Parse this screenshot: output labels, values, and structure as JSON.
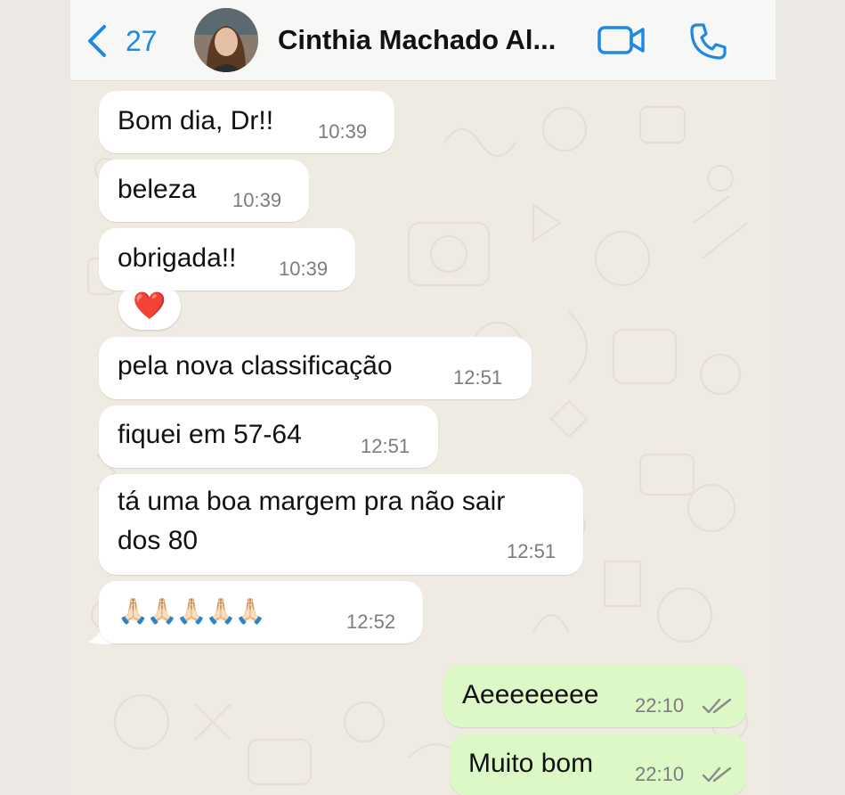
{
  "header": {
    "back_count": "27",
    "contact_name": "Cinthia Machado Al..."
  },
  "messages": [
    {
      "text": "Bom dia, Dr!!",
      "time": "10:39",
      "direction": "in"
    },
    {
      "text": "beleza",
      "time": "10:39",
      "direction": "in"
    },
    {
      "text": "obrigada!!",
      "time": "10:39",
      "direction": "in",
      "reaction": "❤️"
    },
    {
      "text": "pela nova classificação",
      "time": "12:51",
      "direction": "in"
    },
    {
      "text": "fiquei em 57-64",
      "time": "12:51",
      "direction": "in"
    },
    {
      "text_line1": "tá uma boa margem pra não sair",
      "text_line2": "dos 80",
      "time": "12:51",
      "direction": "in"
    },
    {
      "text": "🙏🏻🙏🏻🙏🏻🙏🏻🙏🏻",
      "time": "12:52",
      "direction": "in"
    },
    {
      "text": "Aeeeeeeee",
      "time": "22:10",
      "direction": "out",
      "status": "read"
    },
    {
      "text": "Muito bom",
      "time": "22:10",
      "direction": "out",
      "status": "read"
    }
  ],
  "colors": {
    "accent": "#1e88e5",
    "incoming_bubble": "#ffffff",
    "outgoing_bubble": "#dcf8c6",
    "chat_background": "#efeae2"
  },
  "icons": {
    "back": "chevron-left-icon",
    "video": "video-camera-icon",
    "call": "phone-icon",
    "read_receipt": "double-check-icon"
  }
}
